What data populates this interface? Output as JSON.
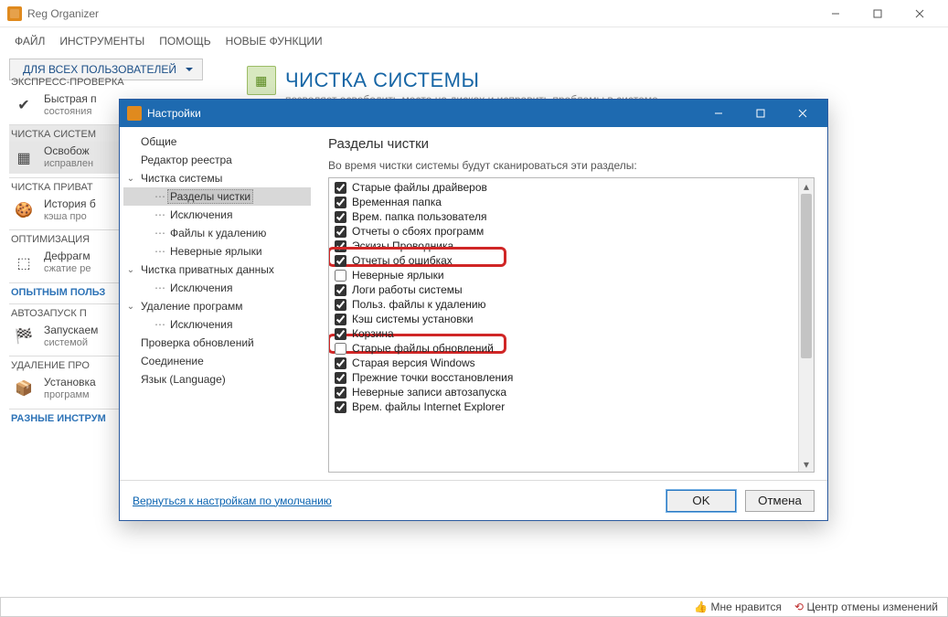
{
  "mainWindow": {
    "title": "Reg Organizer",
    "menu": [
      "ФАЙЛ",
      "ИНСТРУМЕНТЫ",
      "ПОМОЩЬ",
      "НОВЫЕ ФУНКЦИИ"
    ],
    "scopeLabel": "ДЛЯ ВСЕХ ПОЛЬЗОВАТЕЛЕЙ",
    "page": {
      "title": "ЧИСТКА СИСТЕМЫ",
      "subtitle": "позволяет освободить место на дисках и исправить проблемы в системе."
    },
    "sidebar": {
      "groups": [
        {
          "head": "ЭКСПРЕСС-ПРОВЕРКА",
          "items": [
            {
              "title": "Быстрая п",
              "sub": "состояния",
              "icon": "check"
            }
          ]
        },
        {
          "head": "ЧИСТКА СИСТЕМ",
          "sel": true,
          "items": [
            {
              "title": "Освобож",
              "sub": "исправлен",
              "icon": "clean",
              "sel": true
            }
          ]
        },
        {
          "head": "ЧИСТКА ПРИВАТ",
          "items": [
            {
              "title": "История б",
              "sub": "кэша про",
              "icon": "privacy"
            }
          ]
        },
        {
          "head": "ОПТИМИЗАЦИЯ",
          "items": [
            {
              "title": "Дефрагм",
              "sub": "сжатие ре",
              "icon": "defrag"
            }
          ]
        },
        {
          "head": "ОПЫТНЫМ ПОЛЬЗ",
          "blue": true
        },
        {
          "head": "АВТОЗАПУСК П",
          "items": [
            {
              "title": "Запускаем",
              "sub": "системой",
              "icon": "startup"
            }
          ]
        },
        {
          "head": "УДАЛЕНИЕ ПРО",
          "items": [
            {
              "title": "Установка",
              "sub": "программ",
              "icon": "uninstall"
            }
          ]
        },
        {
          "head": "РАЗНЫЕ ИНСТРУМ",
          "blue": true
        }
      ]
    },
    "status": {
      "like": "Мне нравится",
      "undo": "Центр отмены изменений"
    }
  },
  "dialog": {
    "title": "Настройки",
    "tree": [
      {
        "label": "Общие",
        "depth": 0
      },
      {
        "label": "Редактор реестра",
        "depth": 0
      },
      {
        "label": "Чистка системы",
        "depth": 0,
        "exp": "v"
      },
      {
        "label": "Разделы чистки",
        "depth": 1,
        "sel": true
      },
      {
        "label": "Исключения",
        "depth": 1
      },
      {
        "label": "Файлы к удалению",
        "depth": 1
      },
      {
        "label": "Неверные ярлыки",
        "depth": 1
      },
      {
        "label": "Чистка приватных данных",
        "depth": 0,
        "exp": "v"
      },
      {
        "label": "Исключения",
        "depth": 1
      },
      {
        "label": "Удаление программ",
        "depth": 0,
        "exp": "v"
      },
      {
        "label": "Исключения",
        "depth": 1
      },
      {
        "label": "Проверка обновлений",
        "depth": 0
      },
      {
        "label": "Соединение",
        "depth": 0
      },
      {
        "label": "Язык (Language)",
        "depth": 0
      }
    ],
    "panel": {
      "heading": "Разделы чистки",
      "desc": "Во время чистки системы будут сканироваться эти разделы:",
      "items": [
        {
          "label": "Старые файлы драйверов",
          "checked": true
        },
        {
          "label": "Временная папка",
          "checked": true
        },
        {
          "label": "Врем. папка пользователя",
          "checked": true
        },
        {
          "label": "Отчеты о сбоях программ",
          "checked": true
        },
        {
          "label": "Эскизы Проводника",
          "checked": true,
          "hl": true
        },
        {
          "label": "Отчеты об ошибках",
          "checked": true
        },
        {
          "label": "Неверные ярлыки",
          "checked": false
        },
        {
          "label": "Логи работы системы",
          "checked": true
        },
        {
          "label": "Польз. файлы к удалению",
          "checked": true
        },
        {
          "label": "Кэш системы установки",
          "checked": true,
          "hl": true
        },
        {
          "label": "Корзина",
          "checked": true
        },
        {
          "label": "Старые файлы обновлений",
          "checked": false
        },
        {
          "label": "Старая версия Windows",
          "checked": true
        },
        {
          "label": "Прежние точки восстановления",
          "checked": true
        },
        {
          "label": "Неверные записи автозапуска",
          "checked": true
        },
        {
          "label": "Врем. файлы Internet Explorer",
          "checked": true
        }
      ]
    },
    "footer": {
      "resetLink": "Вернуться к настройкам по умолчанию",
      "ok": "OK",
      "cancel": "Отмена"
    }
  }
}
